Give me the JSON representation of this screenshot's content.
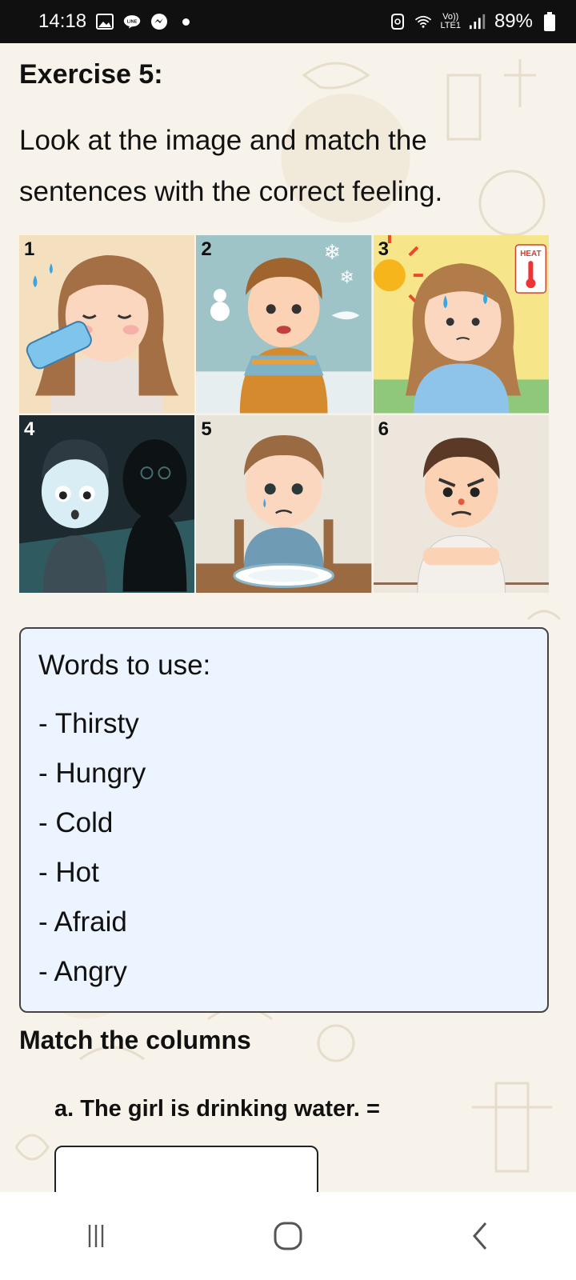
{
  "status_bar": {
    "time": "14:18",
    "battery": "89%",
    "network_top": "Vo))",
    "network_bottom": "LTE1",
    "icons": [
      "gallery-icon",
      "line-icon",
      "messenger-icon",
      "notification-dot-icon",
      "data-saver-icon",
      "wifi-icon",
      "signal-icon",
      "battery-icon"
    ]
  },
  "exercise": {
    "title": "Exercise 5:",
    "instructions": "Look at the image and match the sentences with the correct feeling."
  },
  "image_grid": {
    "tiles": [
      {
        "number": "1",
        "depicts": "girl drinking water"
      },
      {
        "number": "2",
        "depicts": "boy shivering in scarf"
      },
      {
        "number": "3",
        "depicts": "girl sweating under sun",
        "sign": "HEAT"
      },
      {
        "number": "4",
        "depicts": "scared boy with shadow"
      },
      {
        "number": "5",
        "depicts": "sad boy with empty plate"
      },
      {
        "number": "6",
        "depicts": "angry boy with crossed arms"
      }
    ]
  },
  "words_box": {
    "title": "Words to use:",
    "words": [
      "- Thirsty",
      "- Hungry",
      "- Cold",
      "- Hot",
      "- Afraid",
      "- Angry"
    ]
  },
  "match": {
    "heading": "Match the columns",
    "question": "a. The girl is drinking water. =",
    "answer_value": ""
  },
  "nav_bar": {
    "icons": [
      "recent-apps-icon",
      "home-icon",
      "back-icon"
    ]
  },
  "colors": {
    "status_bar_bg": "#101010",
    "page_bg": "#f8f3ea",
    "words_box_bg": "#ebf4ff",
    "nav_bg": "#ffffff"
  }
}
